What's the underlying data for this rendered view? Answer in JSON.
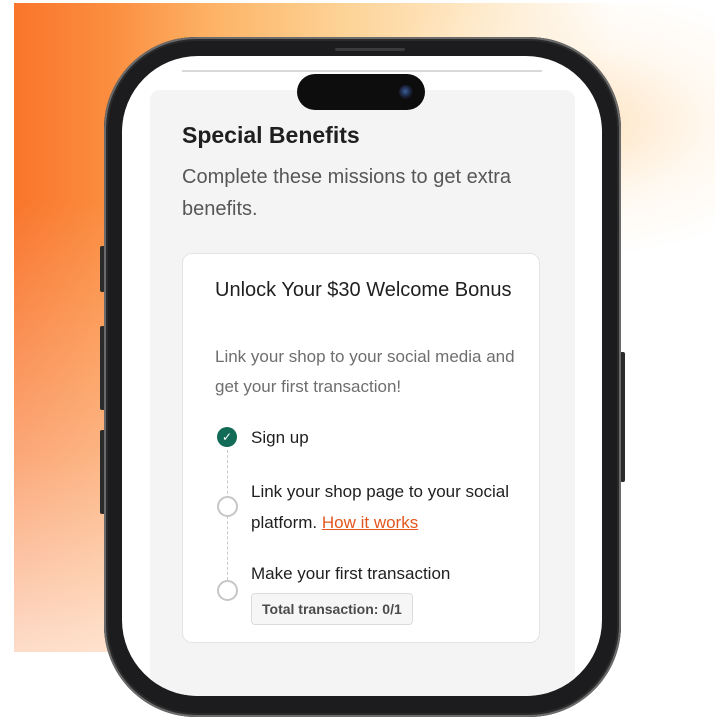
{
  "benefits": {
    "title": "Special Benefits",
    "subtitle": "Complete these missions to get extra benefits."
  },
  "mission_card": {
    "title": "Unlock Your $30 Welcome Bonus",
    "description": "Link your shop to your social media and get your first transaction!",
    "steps": [
      {
        "label": "Sign up",
        "status": "completed",
        "icon": "check-circle-icon"
      },
      {
        "label": "Link your shop page to your social platform.",
        "link_text": "How it works",
        "status": "pending",
        "icon": "empty-circle-icon"
      },
      {
        "label": "Make your first transaction",
        "status": "pending",
        "icon": "empty-circle-icon",
        "progress_badge": "Total transaction: 0/1"
      }
    ]
  },
  "colors": {
    "accent": "#e3561f",
    "success": "#126b56",
    "background_gradient_start": "#f9752c",
    "background_gradient_end": "#ffffff"
  }
}
